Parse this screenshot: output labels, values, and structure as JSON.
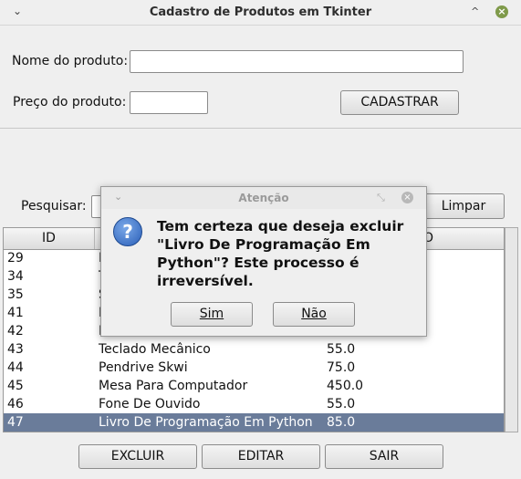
{
  "window": {
    "title": "Cadastro de Produtos em Tkinter",
    "menu_glyph": "⌄",
    "minimize_glyph": "^",
    "close_glyph": "×"
  },
  "form": {
    "name_label": "Nome do produto:",
    "name_value": "",
    "price_label": "Preço do produto:",
    "price_value": "",
    "submit_label": "CADASTRAR"
  },
  "search": {
    "label": "Pesquisar:",
    "value": "",
    "clear_label": "Limpar"
  },
  "table": {
    "columns": [
      "ID",
      "",
      "O"
    ],
    "rows": [
      {
        "id": "29",
        "name": "M",
        "price": ""
      },
      {
        "id": "34",
        "name": "T",
        "price": ""
      },
      {
        "id": "35",
        "name": "S",
        "price": ""
      },
      {
        "id": "41",
        "name": "M",
        "price": ""
      },
      {
        "id": "42",
        "name": "M",
        "price": ""
      },
      {
        "id": "43",
        "name": "Teclado Mecânico",
        "price": "55.0"
      },
      {
        "id": "44",
        "name": "Pendrive Skwi",
        "price": "75.0"
      },
      {
        "id": "45",
        "name": "Mesa Para Computador",
        "price": "450.0"
      },
      {
        "id": "46",
        "name": "Fone De Ouvido",
        "price": "55.0"
      },
      {
        "id": "47",
        "name": "Livro De Programação Em Python",
        "price": "85.0"
      }
    ],
    "selected_id": "47"
  },
  "actions": {
    "delete_label": "EXCLUIR",
    "edit_label": "EDITAR",
    "exit_label": "SAIR"
  },
  "dialog": {
    "title": "Atenção",
    "icon": "question-icon",
    "icon_glyph": "?",
    "message": "Tem certeza que deseja excluir \"Livro De Programação Em Python\"? Este processo é irreversível.",
    "yes_label": "Sim",
    "no_label": "Não"
  },
  "colors": {
    "selection": "#6a7c9a",
    "accent_close": "#7f9a4a"
  }
}
